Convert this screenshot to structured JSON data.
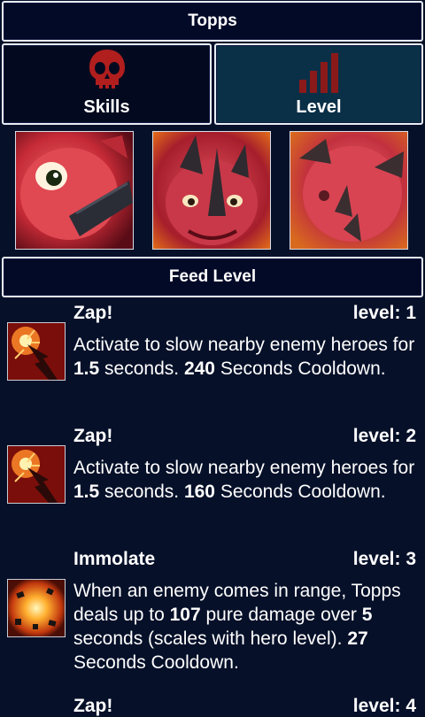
{
  "header": {
    "title": "Topps"
  },
  "tabs": [
    {
      "label": "Skills",
      "icon": "skull-icon"
    },
    {
      "label": "Level",
      "icon": "bars-icon"
    }
  ],
  "portraits": [
    {
      "icon": "hero-portrait-icon"
    },
    {
      "icon": "hero-portrait-icon"
    },
    {
      "icon": "hero-portrait-icon"
    }
  ],
  "feed": {
    "title": "Feed Level"
  },
  "skills": [
    {
      "name": "Zap!",
      "level": "level: 1",
      "desc": [
        "Activate to slow nearby enemy heroes for ",
        "1.5",
        " seconds. ",
        "240",
        " Seconds Cooldown."
      ]
    },
    {
      "name": "Zap!",
      "level": "level: 2",
      "desc": [
        "Activate to slow nearby enemy heroes for ",
        "1.5",
        " seconds. ",
        "160",
        " Seconds Cooldown."
      ]
    },
    {
      "name": "Immolate",
      "level": "level: 3",
      "desc": [
        "When an enemy comes in range, Topps deals up to ",
        "107",
        " pure damage over ",
        "5",
        " seconds (scales with hero level). ",
        "27",
        " Seconds Cooldown."
      ]
    },
    {
      "name": "Zap!",
      "level": "level: 4"
    }
  ],
  "colors": {
    "accent": "#b01e1e",
    "background": "#061029",
    "tab_active": "#0a3048"
  }
}
